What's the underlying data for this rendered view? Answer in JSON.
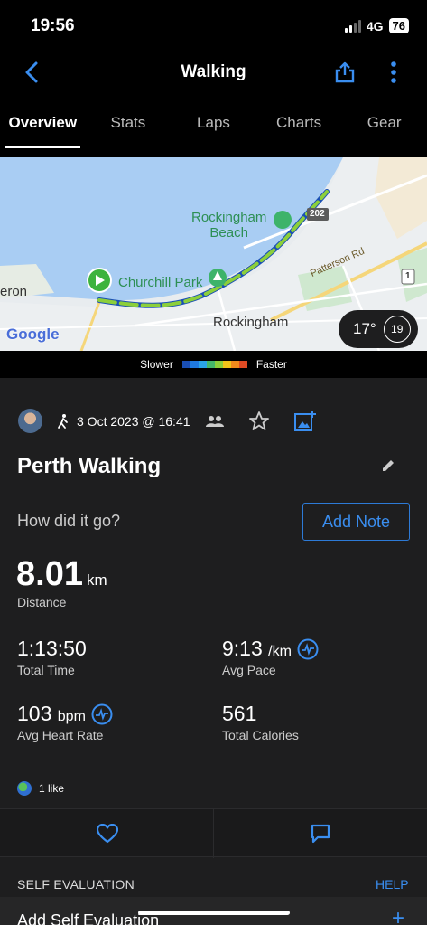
{
  "status": {
    "time": "19:56",
    "network": "4G",
    "battery": "76"
  },
  "nav": {
    "title": "Walking"
  },
  "tabs": [
    {
      "label": "Overview"
    },
    {
      "label": "Stats"
    },
    {
      "label": "Laps"
    },
    {
      "label": "Charts"
    },
    {
      "label": "Gear"
    }
  ],
  "map": {
    "labels": {
      "rockingham_beach_1": "Rockingham",
      "rockingham_beach_2": "Beach",
      "churchill_park": "Churchill Park",
      "patterson_rd": "Patterson Rd",
      "rockingham": "Rockingham",
      "eron": "eron",
      "road_202": "202",
      "road_1": "1",
      "google": "Google"
    },
    "weather": {
      "temp": "17°",
      "wind": "19"
    }
  },
  "legend": {
    "slower": "Slower",
    "faster": "Faster",
    "colors": [
      "#1a4fb5",
      "#1f7ae0",
      "#2aa5e8",
      "#45b86a",
      "#8ccf3a",
      "#f0c419",
      "#f28a1c",
      "#e04b24"
    ]
  },
  "activity": {
    "date": "3 Oct 2023 @ 16:41",
    "title": "Perth Walking",
    "prompt": "How did it go?",
    "add_note": "Add Note",
    "distance_value": "8.01",
    "distance_unit": "km",
    "distance_label": "Distance",
    "total_time_value": "1:13:50",
    "total_time_label": "Total Time",
    "avg_pace_value": "9:13",
    "avg_pace_unit": "/km",
    "avg_pace_label": "Avg Pace",
    "avg_hr_value": "103",
    "avg_hr_unit": "bpm",
    "avg_hr_label": "Avg Heart Rate",
    "calories_value": "561",
    "calories_label": "Total Calories",
    "likes": "1 like"
  },
  "self_eval": {
    "heading": "SELF EVALUATION",
    "help": "HELP",
    "add_label": "Add Self Evaluation",
    "add_icon": "+"
  }
}
